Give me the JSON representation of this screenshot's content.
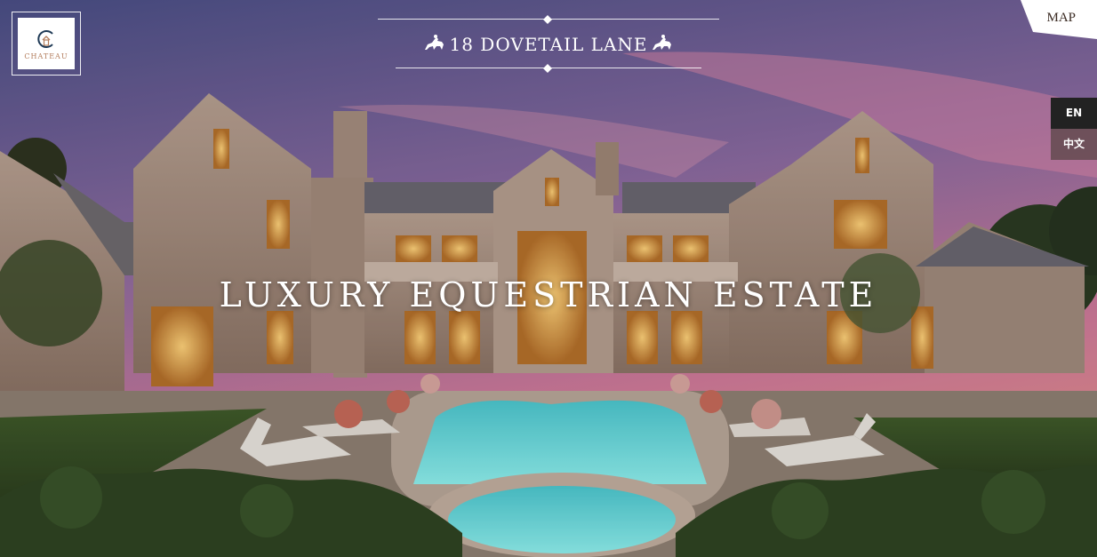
{
  "brand": {
    "logo_text": "CHATEAU",
    "icon": "chateau-logo-icon"
  },
  "header": {
    "title": "18 DOVETAIL LANE",
    "left_icon": "horse-rider-icon",
    "right_icon": "horse-rider-icon"
  },
  "nav": {
    "map_label": "MAP"
  },
  "language": {
    "options": [
      {
        "label": "EN",
        "active": true
      },
      {
        "label": "中文",
        "active": false
      }
    ]
  },
  "hero": {
    "headline": "LUXURY EQUESTRIAN ESTATE"
  },
  "colors": {
    "logo_accent": "#b27b5a",
    "lang_active_bg": "#222222",
    "text": "#ffffff",
    "sky_top": "#5a5a8c",
    "sky_bottom": "#e0809a",
    "pool": "#5fd3d8"
  }
}
